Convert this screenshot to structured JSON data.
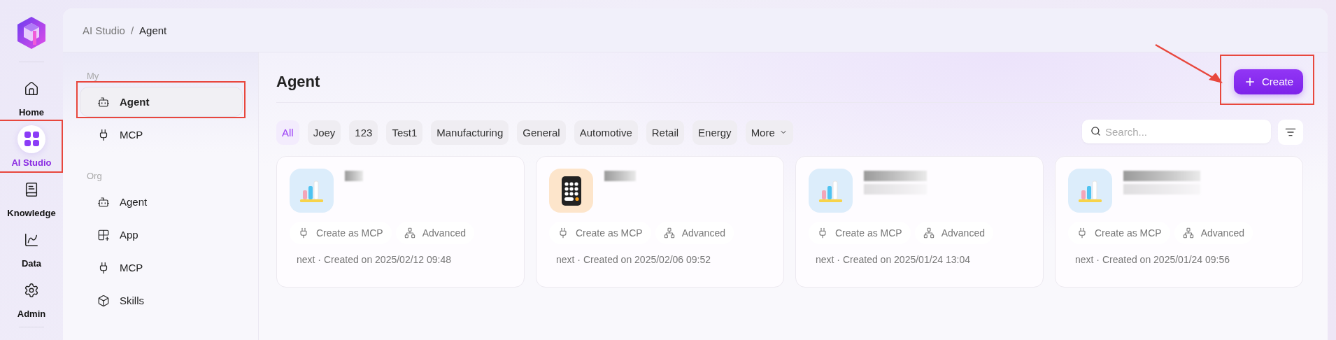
{
  "breadcrumb": [
    {
      "label": "AI Studio",
      "current": false
    },
    {
      "label": "/",
      "current": false
    },
    {
      "label": "Agent",
      "current": true
    }
  ],
  "rail": [
    {
      "label": "Home",
      "kind": "home",
      "selected": false,
      "annotated": false
    },
    {
      "label": "AI Studio",
      "kind": "grid",
      "selected": true,
      "annotated": true
    },
    {
      "label": "Knowledge",
      "kind": "book",
      "selected": false,
      "annotated": false
    },
    {
      "label": "Data",
      "kind": "chart",
      "selected": false,
      "annotated": false
    },
    {
      "label": "Admin",
      "kind": "gear",
      "selected": false,
      "annotated": false
    }
  ],
  "sidebar": [
    {
      "heading": "My",
      "items": [
        {
          "label": "Agent",
          "kind": "robot",
          "selected": true,
          "annotated": true
        },
        {
          "label": "MCP",
          "kind": "plug",
          "selected": false,
          "annotated": false
        }
      ]
    },
    {
      "heading": "Org",
      "items": [
        {
          "label": "Agent",
          "kind": "robot",
          "selected": false,
          "annotated": false
        },
        {
          "label": "App",
          "kind": "apps",
          "selected": false,
          "annotated": false
        },
        {
          "label": "MCP",
          "kind": "plug",
          "selected": false,
          "annotated": false
        },
        {
          "label": "Skills",
          "kind": "cube",
          "selected": false,
          "annotated": false
        }
      ]
    }
  ],
  "page": {
    "title": "Agent",
    "create_button": {
      "label": "Create",
      "annotated": true,
      "pointer_arrow": true
    }
  },
  "filters": [
    {
      "label": "All",
      "selected": true,
      "kind": "chip"
    },
    {
      "label": "Joey",
      "selected": false,
      "kind": "chip"
    },
    {
      "label": "123",
      "selected": false,
      "kind": "chip"
    },
    {
      "label": "Test1",
      "selected": false,
      "kind": "chip"
    },
    {
      "label": "Manufacturing",
      "selected": false,
      "kind": "chip"
    },
    {
      "label": "General",
      "selected": false,
      "kind": "chip"
    },
    {
      "label": "Automotive",
      "selected": false,
      "kind": "chip"
    },
    {
      "label": "Retail",
      "selected": false,
      "kind": "chip"
    },
    {
      "label": "Energy",
      "selected": false,
      "kind": "chip"
    },
    {
      "label": "More",
      "selected": false,
      "kind": "dropdown"
    }
  ],
  "search": {
    "placeholder": "Search..."
  },
  "cards": [
    {
      "kind": "chart",
      "actions": [
        {
          "label": "Create as MCP",
          "kind": "plug"
        },
        {
          "label": "Advanced",
          "kind": "sitemap"
        }
      ],
      "meta": "next · Created on 2025/02/12 09:48"
    },
    {
      "kind": "calculator",
      "actions": [
        {
          "label": "Create as MCP",
          "kind": "plug"
        },
        {
          "label": "Advanced",
          "kind": "sitemap"
        }
      ],
      "meta": "next · Created on 2025/02/06 09:52"
    },
    {
      "kind": "chart",
      "actions": [
        {
          "label": "Create as MCP",
          "kind": "plug"
        },
        {
          "label": "Advanced",
          "kind": "sitemap"
        }
      ],
      "meta": "next · Created on 2025/01/24 13:04"
    },
    {
      "kind": "chart",
      "actions": [
        {
          "label": "Create as MCP",
          "kind": "plug"
        },
        {
          "label": "Advanced",
          "kind": "sitemap"
        }
      ],
      "meta": "next · Created on 2025/01/24 09:56"
    }
  ]
}
